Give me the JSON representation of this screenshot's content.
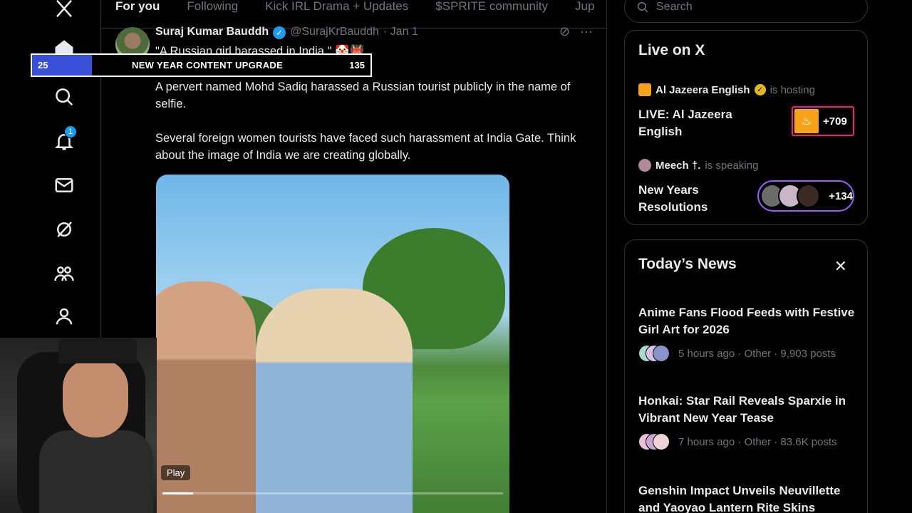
{
  "nav": {
    "notifications_count": "1"
  },
  "tabs": [
    "For you",
    "Following",
    "Kick IRL Drama + Updates",
    "$SPRITE community",
    "Jup"
  ],
  "post": {
    "author": "Suraj Kumar Bauddh",
    "handle": "@SurajKrBauddh",
    "date": "· Jan 1",
    "line1": "\"A Russian girl harassed in India.\" 🤡👹",
    "line2": "A pervert named Mohd Sadiq harassed a Russian tourist publicly in the name of selfie.",
    "line3": "Several foreign women tourists have faced such harassment at India Gate. Think about the image of India we are creating globally.",
    "play_label": "Play",
    "video_progress": 0.09
  },
  "overlay": {
    "left": "25",
    "middle": "NEW YEAR CONTENT UPGRADE",
    "right": "135"
  },
  "search": {
    "placeholder": "Search"
  },
  "live": {
    "title": "Live on X",
    "items": [
      {
        "host": "Al Jazeera English",
        "status": "is hosting",
        "title": "LIVE: Al Jazeera English",
        "count": "+709"
      },
      {
        "host": "Meech †.",
        "status": "is speaking",
        "title": "New Years Resolutions",
        "count": "+134"
      }
    ]
  },
  "news": {
    "title": "Today’s News",
    "close": "✕",
    "items": [
      {
        "title": "Anime Fans Flood Feeds with Festive Girl Art for 2026",
        "meta": "5 hours ago · Other · 9,903 posts"
      },
      {
        "title": "Honkai: Star Rail Reveals Sparxie in Vibrant New Year Tease",
        "meta": "7 hours ago · Other · 83.6K posts"
      },
      {
        "title": "Genshin Impact Unveils Neuvillette and Yaoyao Lantern Rite Skins",
        "meta": ""
      }
    ]
  },
  "colors": {
    "accent": "#1d9bf0",
    "live_pink": "#f91880",
    "live_purple": "#9d5cf5",
    "overlay_blue": "#3a4fd9"
  }
}
